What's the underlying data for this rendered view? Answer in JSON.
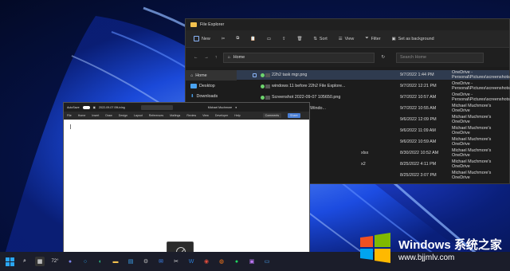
{
  "file_explorer": {
    "title": "File Explorer",
    "toolbar": {
      "new": "New",
      "sort": "Sort",
      "view": "View",
      "filter": "Filter",
      "set_bg": "Set as background"
    },
    "address": "Home",
    "search_placeholder": "Search Home",
    "sidebar": [
      {
        "label": "Home"
      },
      {
        "label": "Desktop"
      },
      {
        "label": "Downloads"
      }
    ],
    "rows": [
      {
        "name": "22h2 task mgr.png",
        "date": "9/7/2022 1:44 PM",
        "location": "OneDrive - Personal\\Pictures\\screenshots"
      },
      {
        "name": "windows 11 before 22h2 File Explore...",
        "date": "9/7/2022 12:21 PM",
        "location": "OneDrive - Personal\\Pictures\\screenshots"
      },
      {
        "name": "Screenshot 2022-09-07 105650.png",
        "date": "9/7/2022 10:57 AM",
        "location": "OneDrive - Personal\\Pictures\\screenshots"
      },
      {
        "name": "atures in Windo...",
        "date": "9/7/2022 10:55 AM",
        "location": "Michael Muchmore's OneDrive"
      },
      {
        "name": "",
        "date": "9/6/2022 12:09 PM",
        "location": "Michael Muchmore's OneDrive"
      },
      {
        "name": "",
        "date": "9/6/2022 11:09 AM",
        "location": "Michael Muchmore's OneDrive"
      },
      {
        "name": "",
        "date": "9/6/2022 10:59 AM",
        "location": "Michael Muchmore's OneDrive"
      },
      {
        "name": "xlsx",
        "date": "8/30/2022 10:52 AM",
        "location": "Michael Muchmore's OneDrive"
      },
      {
        "name": "x2",
        "date": "8/25/2022 4:11 PM",
        "location": "Michael Muchmore's OneDrive"
      },
      {
        "name": "",
        "date": "8/25/2022 3:07 PM",
        "location": "Michael Muchmore's OneDrive"
      }
    ]
  },
  "word": {
    "autosave": "AutoSave",
    "doc_title": "2022-09-07 09Living",
    "user": "Michael Muchmore",
    "comments": "Comments",
    "share": "Share",
    "ribbon_tabs": [
      "File",
      "Home",
      "Insert",
      "Draw",
      "Design",
      "Layout",
      "References",
      "Mailings",
      "Review",
      "View",
      "Developer",
      "Help"
    ]
  },
  "taskbar": {
    "weather": "72°"
  },
  "watermark": {
    "brand": "Windows 系统之家",
    "url": "www.bjjmlv.com"
  }
}
